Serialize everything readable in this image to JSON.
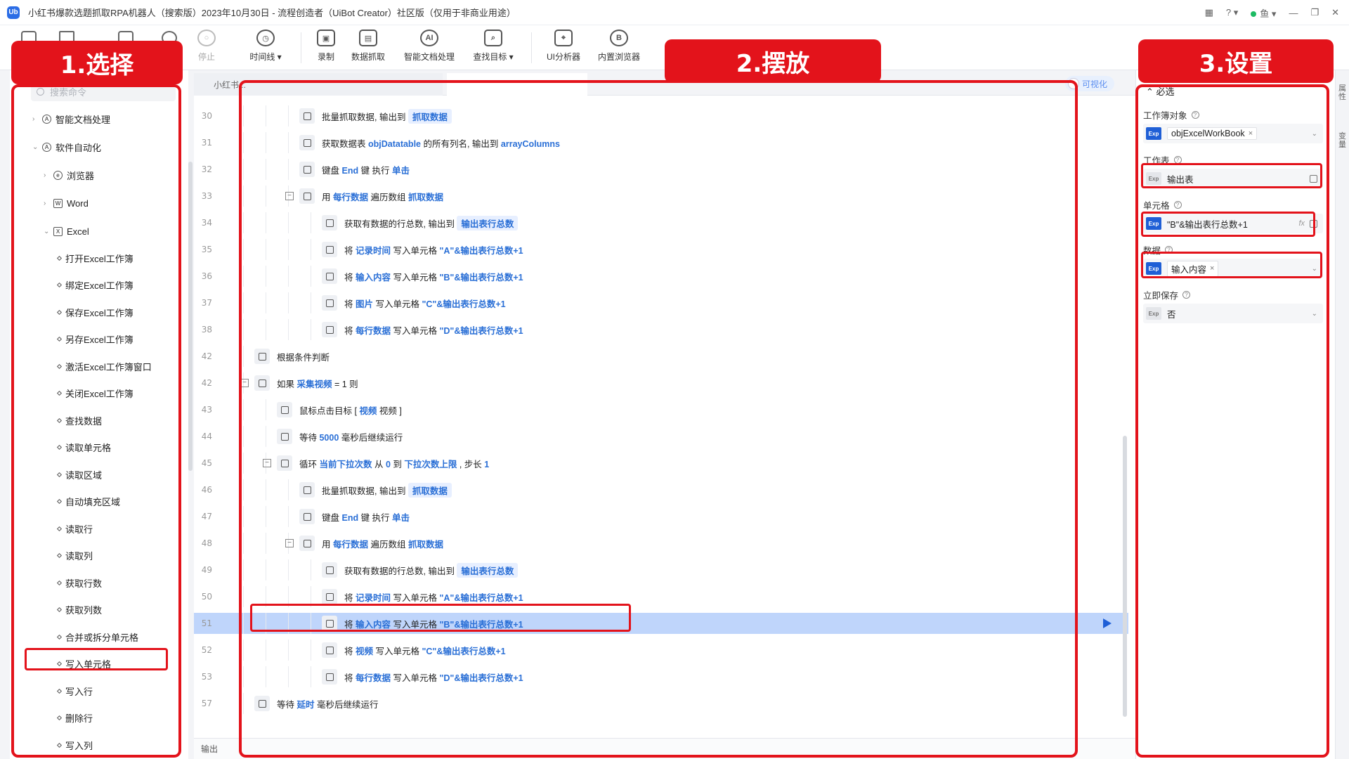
{
  "window": {
    "title": "小红书爆款选题抓取RPA机器人（搜索版）2023年10月30日 - 流程创造者（UiBot Creator）社区版（仅用于非商业用途）",
    "user": "鱼"
  },
  "toolbar": {
    "stop": "停止",
    "timeline": "时间线 ▾",
    "record": "录制",
    "data_scrape": "数据抓取",
    "smart_doc": "智能文档处理",
    "find_target": "查找目标 ▾",
    "ui_analyzer": "UI分析器",
    "builtin_browser": "内置浏览器"
  },
  "annotations": {
    "label_select": "1.选择",
    "label_place": "2.摆放",
    "label_settings": "3.设置"
  },
  "left_panel": {
    "search_placeholder": "搜索命令",
    "items": [
      {
        "label": "智能文档处理"
      },
      {
        "label": "软件自动化"
      },
      {
        "label": "浏览器"
      },
      {
        "label": "Word"
      },
      {
        "label": "Excel"
      },
      {
        "label": "打开Excel工作簿"
      },
      {
        "label": "绑定Excel工作簿"
      },
      {
        "label": "保存Excel工作簿"
      },
      {
        "label": "另存Excel工作簿"
      },
      {
        "label": "激活Excel工作簿窗口"
      },
      {
        "label": "关闭Excel工作簿"
      },
      {
        "label": "查找数据"
      },
      {
        "label": "读取单元格"
      },
      {
        "label": "读取区域"
      },
      {
        "label": "自动填充区域"
      },
      {
        "label": "读取行"
      },
      {
        "label": "读取列"
      },
      {
        "label": "获取行数"
      },
      {
        "label": "获取列数"
      },
      {
        "label": "合并或拆分单元格"
      },
      {
        "label": "写入单元格"
      },
      {
        "label": "写入行"
      },
      {
        "label": "删除行"
      },
      {
        "label": "写入列"
      }
    ]
  },
  "editor": {
    "tab1": "小红书...",
    "visualize_label": "可视化",
    "output_label": "输出",
    "rows": [
      {
        "ln": "30",
        "parts": [
          "批量抓取数据, 输出到 ",
          "抓取数据"
        ]
      },
      {
        "ln": "31",
        "parts": [
          "获取数据表 ",
          "objDatatable",
          " 的所有列名, 输出到 ",
          "arrayColumns"
        ]
      },
      {
        "ln": "32",
        "parts": [
          "键盘 ",
          "End",
          " 键 执行 ",
          "单击"
        ]
      },
      {
        "ln": "33",
        "parts": [
          "用 ",
          "每行数据",
          " 遍历数组 ",
          "抓取数据"
        ]
      },
      {
        "ln": "34",
        "parts": [
          "获取有数据的行总数, 输出到 ",
          "输出表行总数"
        ]
      },
      {
        "ln": "35",
        "parts": [
          "将 ",
          "记录时间",
          " 写入单元格 ",
          "\"A\"&输出表行总数+1"
        ]
      },
      {
        "ln": "36",
        "parts": [
          "将 ",
          "输入内容",
          " 写入单元格 ",
          "\"B\"&输出表行总数+1"
        ]
      },
      {
        "ln": "37",
        "parts": [
          "将 ",
          "图片",
          " 写入单元格 ",
          "\"C\"&输出表行总数+1"
        ]
      },
      {
        "ln": "38",
        "parts": [
          "将 ",
          "每行数据",
          " 写入单元格 ",
          "\"D\"&输出表行总数+1"
        ]
      },
      {
        "ln": "42",
        "parts": [
          "根据条件判断"
        ]
      },
      {
        "ln": "42",
        "parts": [
          "如果 ",
          "采集视频",
          " = 1 则"
        ]
      },
      {
        "ln": "43",
        "parts": [
          "鼠标点击目标 [ ",
          "视频",
          " 视频 ]"
        ]
      },
      {
        "ln": "44",
        "parts": [
          "等待 ",
          "5000",
          " 毫秒后继续运行"
        ]
      },
      {
        "ln": "45",
        "parts": [
          "循环 ",
          "当前下拉次数",
          " 从 ",
          "0",
          " 到 ",
          "下拉次数上限",
          " , 步长 ",
          "1"
        ]
      },
      {
        "ln": "46",
        "parts": [
          "批量抓取数据, 输出到 ",
          "抓取数据"
        ]
      },
      {
        "ln": "47",
        "parts": [
          "键盘 ",
          "End",
          " 键 执行 ",
          "单击"
        ]
      },
      {
        "ln": "48",
        "parts": [
          "用 ",
          "每行数据",
          " 遍历数组 ",
          "抓取数据"
        ]
      },
      {
        "ln": "49",
        "parts": [
          "获取有数据的行总数, 输出到 ",
          "输出表行总数"
        ]
      },
      {
        "ln": "50",
        "parts": [
          "将 ",
          "记录时间",
          " 写入单元格 ",
          "\"A\"&输出表行总数+1"
        ]
      },
      {
        "ln": "51",
        "parts": [
          "将 ",
          "输入内容",
          " 写入单元格 ",
          "\"B\"&输出表行总数+1"
        ]
      },
      {
        "ln": "52",
        "parts": [
          "将 ",
          "视频",
          " 写入单元格 ",
          "\"C\"&输出表行总数+1"
        ]
      },
      {
        "ln": "53",
        "parts": [
          "将 ",
          "每行数据",
          " 写入单元格 ",
          "\"D\"&输出表行总数+1"
        ]
      },
      {
        "ln": "57",
        "parts": [
          "等待 ",
          "延时",
          " 毫秒后继续运行"
        ]
      }
    ]
  },
  "right_panel": {
    "section": "⌃ 必选",
    "workbook_label": "工作簿对象",
    "workbook_value": "objExcelWorkBook",
    "sheet_label": "工作表",
    "sheet_value": "输出表",
    "cell_label": "单元格",
    "cell_value": "\"B\"&输出表行总数+1",
    "data_label": "数据",
    "data_value": "输入内容",
    "save_label": "立即保存",
    "save_value": "否",
    "exp": "Exp",
    "fx": "fx",
    "vtab1": "属性",
    "vtab2": "变量"
  }
}
